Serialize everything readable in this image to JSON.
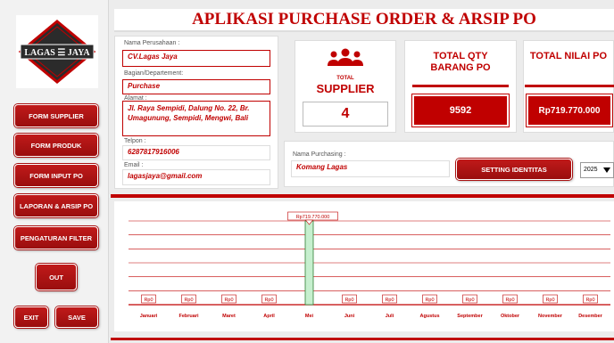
{
  "app": {
    "title": "APLIKASI PURCHASE ORDER & ARSIP PO",
    "logo_text": "LAGAS ☰ JAYA"
  },
  "sidebar": {
    "buttons": [
      {
        "id": "form-supplier",
        "label": "FORM SUPPLIER"
      },
      {
        "id": "form-produk",
        "label": "FORM PRODUK"
      },
      {
        "id": "form-input-po",
        "label": "FORM INPUT PO"
      },
      {
        "id": "laporan-arsip-po",
        "label": "LAPORAN & ARSIP PO"
      },
      {
        "id": "pengaturan-filter",
        "label": "PENGATURAN FILTER"
      }
    ],
    "out_label": "OUT",
    "exit_label": "EXIT",
    "save_label": "SAVE"
  },
  "company": {
    "name_label": "Nama Perusahaan :",
    "name_value": "CV.Lagas Jaya",
    "dept_label": "Bagian/Departement:",
    "dept_value": "Purchase",
    "address_label": "Alamat :",
    "address_value": "Jl. Raya Sempidi, Dalung No. 22, Br. Umagunung, Sempidi, Mengwi, Bali",
    "phone_label": "Telpon :",
    "phone_value": "6287817916006",
    "email_label": "Email :",
    "email_value": "lagasjaya@gmail.com"
  },
  "stats": {
    "supplier_small": "TOTAL",
    "supplier_label": "SUPPLIER",
    "supplier_value": "4",
    "qty_label_1": "TOTAL QTY",
    "qty_label_2": "BARANG PO",
    "qty_value": "9592",
    "nilai_label": "TOTAL NILAI PO",
    "nilai_value": "Rp719.770.000"
  },
  "purchasing": {
    "label": "Nama Purchasing :",
    "value": "Komang Lagas",
    "setting_label": "SETTING IDENTITAS",
    "year_value": "2025"
  },
  "colors": {
    "accent": "#c00000",
    "bar_fill": "#c6efce",
    "bar_stroke": "#2e7d32"
  },
  "chart_data": {
    "type": "bar",
    "categories": [
      "Januari",
      "Februari",
      "Maret",
      "April",
      "Mei",
      "Juni",
      "Juli",
      "Agustus",
      "September",
      "Oktober",
      "November",
      "Desember"
    ],
    "values": [
      0,
      0,
      0,
      0,
      719770000,
      0,
      0,
      0,
      0,
      0,
      0,
      0
    ],
    "data_labels": [
      "Rp0",
      "Rp0",
      "Rp0",
      "Rp0",
      "Rp719.770.000",
      "Rp0",
      "Rp0",
      "Rp0",
      "Rp0",
      "Rp0",
      "Rp0",
      "Rp0"
    ],
    "title": "",
    "xlabel": "",
    "ylabel": "",
    "grid": true,
    "legend": "none"
  }
}
